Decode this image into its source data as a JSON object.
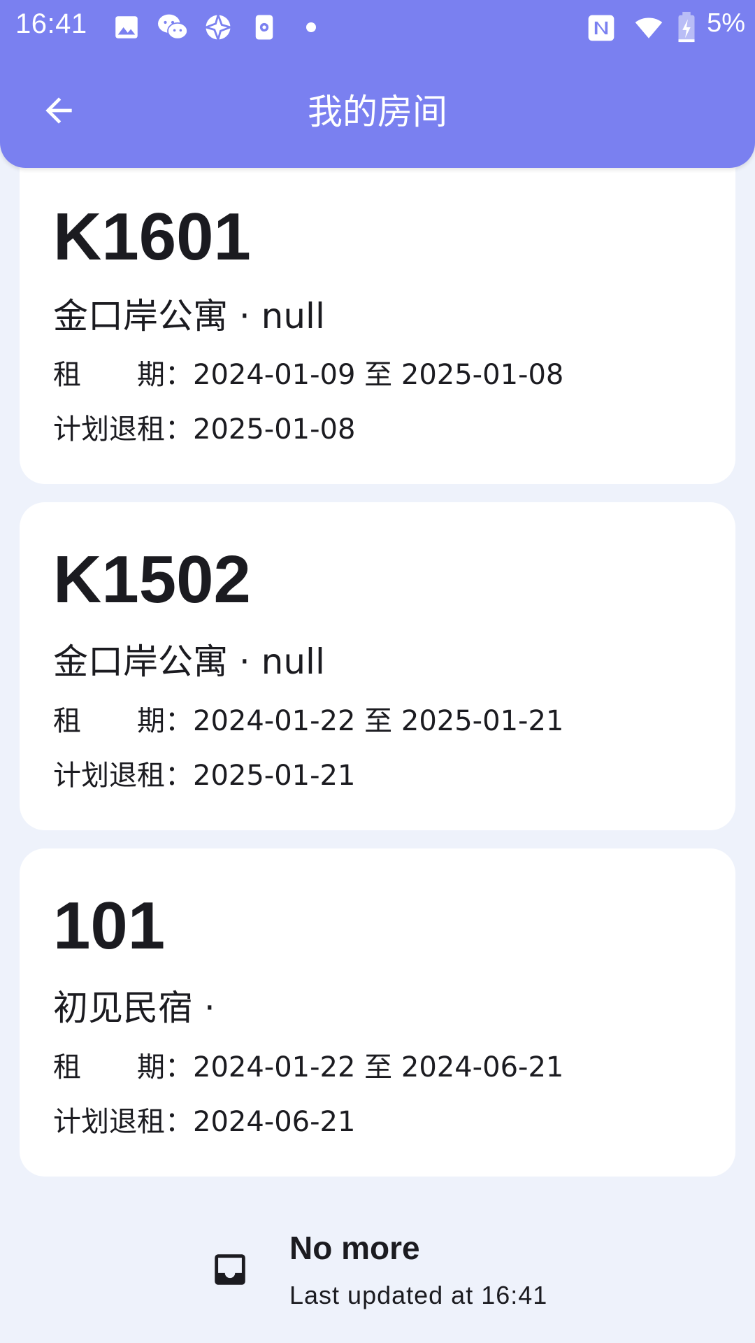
{
  "status_bar": {
    "time": "16:41",
    "battery": "5%",
    "icons": [
      "gallery-icon",
      "wechat-icon",
      "aperture-icon",
      "phone-settings-icon",
      "dot-icon",
      "nfc-icon",
      "wifi-icon",
      "battery-charging-icon"
    ]
  },
  "header": {
    "title": "我的房间",
    "back_icon": "arrow-left-icon"
  },
  "rooms": [
    {
      "number": "K1601",
      "building": "金口岸公寓 · null",
      "lease_line": "租　　期：2024-01-09 至 2025-01-08",
      "planned_checkout_line": "计划退租：2025-01-08"
    },
    {
      "number": "K1502",
      "building": "金口岸公寓 · null",
      "lease_line": "租　　期：2024-01-22 至 2025-01-21",
      "planned_checkout_line": "计划退租：2025-01-21"
    },
    {
      "number": "101",
      "building": "初见民宿 ·",
      "lease_line": "租　　期：2024-01-22 至 2024-06-21",
      "planned_checkout_line": "计划退租：2024-06-21"
    }
  ],
  "footer": {
    "title": "No more",
    "subtitle": "Last updated at 16:41",
    "icon": "inbox-icon"
  },
  "colors": {
    "primary": "#7a80f0",
    "background": "#eef2fb",
    "card": "#ffffff",
    "text": "#1b1b20"
  }
}
